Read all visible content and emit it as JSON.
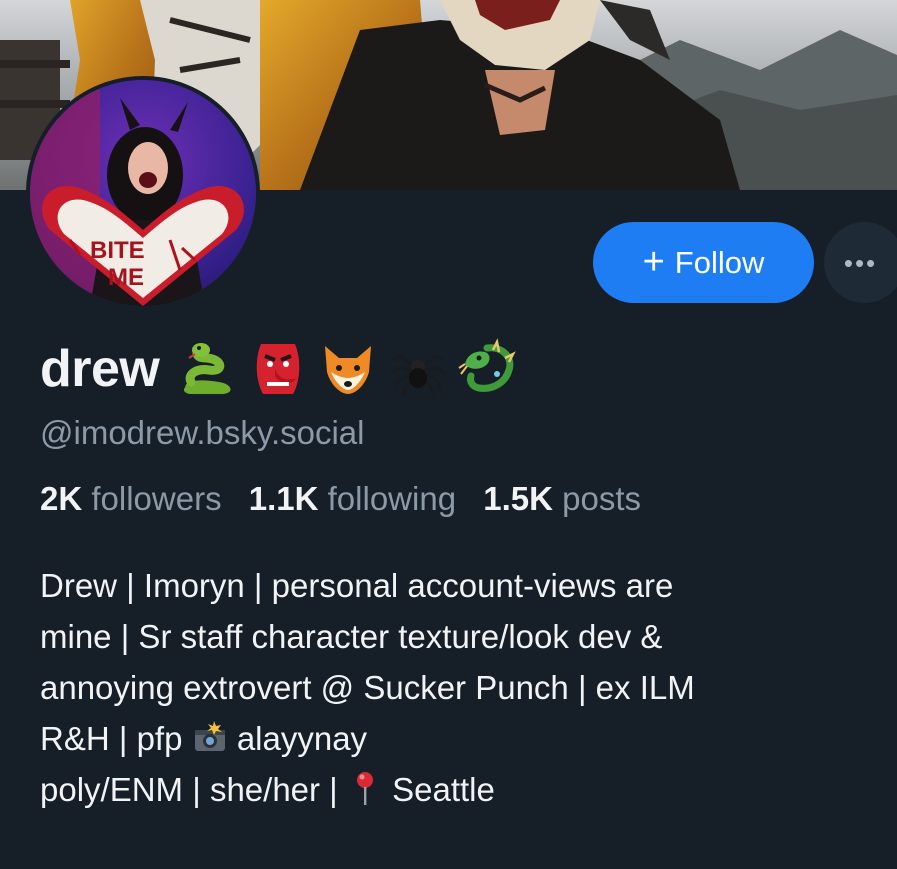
{
  "profile": {
    "display_name": "drew",
    "name_emojis": [
      "snake-emoji",
      "goblin-mask-emoji",
      "fox-emoji",
      "spider-emoji",
      "dragon-emoji"
    ],
    "handle": "@imodrew.bsky.social",
    "avatar_text": "BITE ME",
    "stats": {
      "followers_count": "2K",
      "followers_label": "followers",
      "following_count": "1.1K",
      "following_label": "following",
      "posts_count": "1.5K",
      "posts_label": "posts"
    },
    "bio": {
      "line1": "Drew | Imoryn | personal account-views are",
      "line2": "mine | Sr staff character texture/look dev &",
      "line3": "annoying extrovert @ Sucker Punch | ex ILM",
      "line4_a": "R&H | pfp",
      "line4_b": "alayynay",
      "line5_a": "poly/ENM | she/her |",
      "line5_b": "Seattle"
    }
  },
  "actions": {
    "follow_label": "Follow",
    "more_label": "•••"
  },
  "colors": {
    "background": "#161e27",
    "accent": "#1e7df2",
    "muted_text": "#8c9aa8",
    "primary_text": "#f1f3f5"
  }
}
